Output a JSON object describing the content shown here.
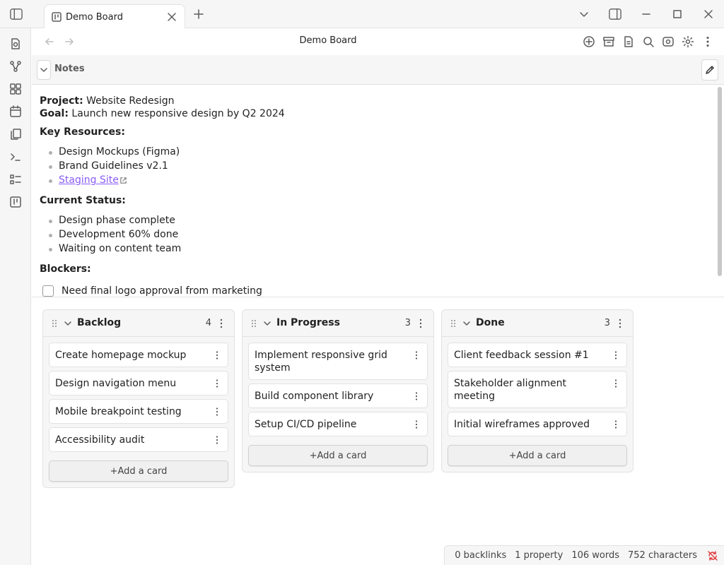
{
  "titlebar": {
    "tab_title": "Demo Board"
  },
  "view": {
    "title": "Demo Board"
  },
  "notes": {
    "header": "Notes",
    "project_label": "Project:",
    "project_value": "Website Redesign",
    "goal_label": "Goal:",
    "goal_value": "Launch new responsive design by Q2 2024",
    "key_resources_heading": "Key Resources:",
    "resources": [
      "Design Mockups (Figma)",
      "Brand Guidelines v2.1"
    ],
    "staging_link": "Staging Site",
    "status_heading": "Current Status:",
    "status_items": [
      "Design phase complete",
      "Development 60% done",
      "Waiting on content team"
    ],
    "blockers_heading": "Blockers:",
    "blockers": [
      "Need final logo approval from marketing"
    ]
  },
  "board": {
    "add_card_label": "+Add a card",
    "lanes": [
      {
        "title": "Backlog",
        "count": "4",
        "cards": [
          "Create homepage mockup",
          "Design navigation menu",
          "Mobile breakpoint testing",
          "Accessibility audit"
        ]
      },
      {
        "title": "In Progress",
        "count": "3",
        "cards": [
          "Implement responsive grid system",
          "Build component library",
          "Setup CI/CD pipeline"
        ]
      },
      {
        "title": "Done",
        "count": "3",
        "cards": [
          "Client feedback session #1",
          "Stakeholder alignment meeting",
          "Initial wireframes approved"
        ]
      }
    ]
  },
  "statusbar": {
    "backlinks": "0 backlinks",
    "properties": "1 property",
    "words": "106 words",
    "characters": "752 characters"
  },
  "colors": {
    "accent_link": "#8a5cf5",
    "sync_error": "#e03e3e"
  }
}
